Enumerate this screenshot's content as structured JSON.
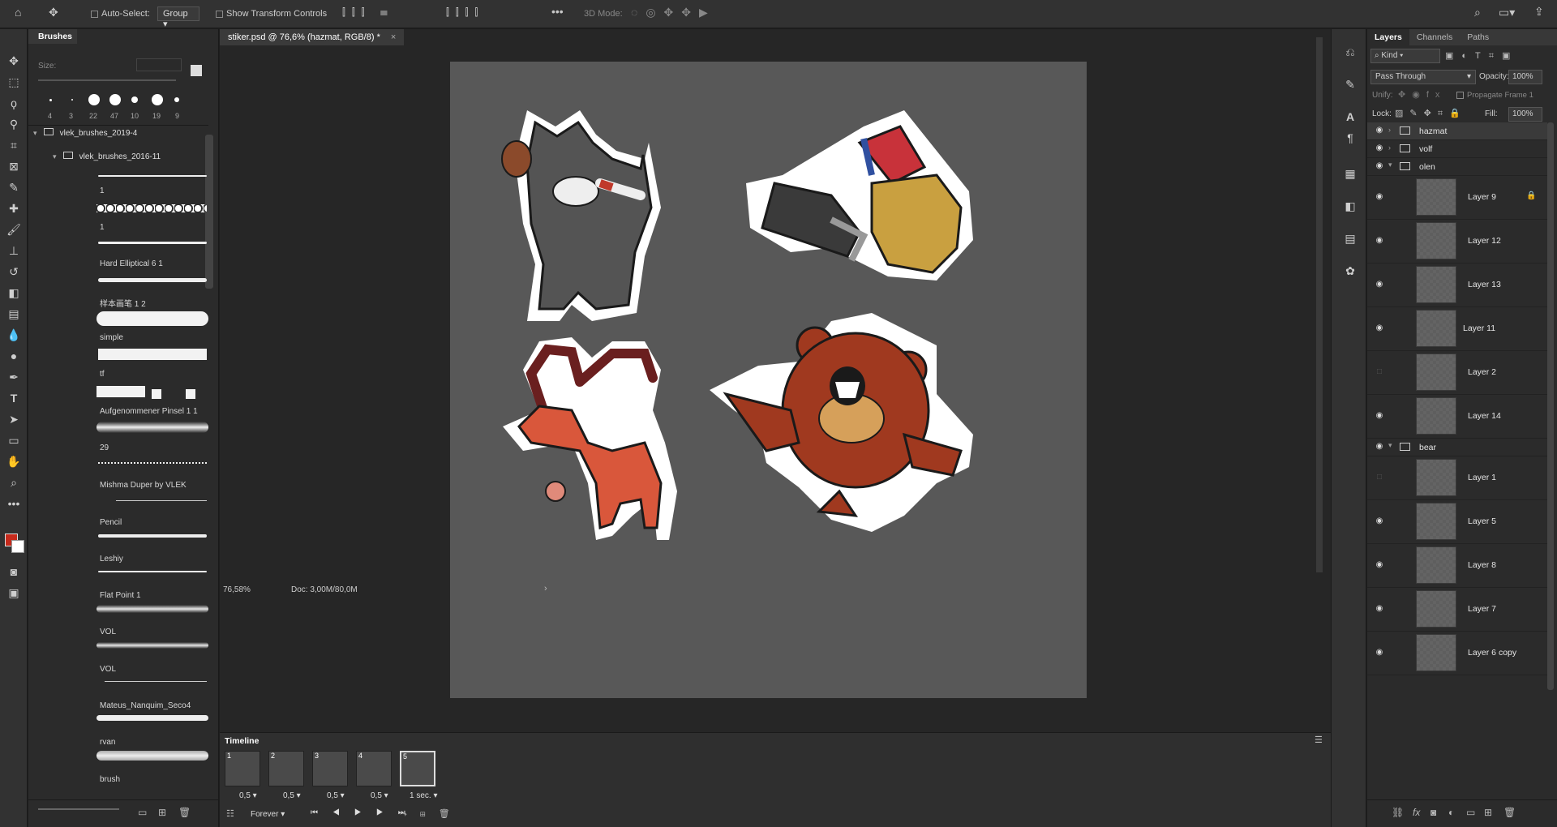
{
  "options_bar": {
    "auto_select_label": "Auto-Select:",
    "auto_select_value": "Group",
    "transform_label": "Show Transform Controls",
    "mode_3d_label": "3D Mode:"
  },
  "brushes_panel": {
    "title": "Brushes",
    "size_label": "Size:",
    "presets": [
      "4",
      "3",
      "22",
      "47",
      "10",
      "19",
      "9"
    ],
    "group1": "vlek_brushes_2019-4",
    "group2": "vlek_brushes_2016-11",
    "items": [
      "1",
      "1",
      "Hard Elliptical 6 1",
      "样本画笔 1 2",
      "simple",
      "tf",
      "Aufgenommener Pinsel 1 1",
      "29",
      "Mishma Duper by VLEK",
      "Pencil",
      "Leshiy",
      "Flat Point 1",
      "VOL",
      "VOL",
      "Mateus_Nanquim_Seco4",
      "rvan",
      "brush"
    ]
  },
  "document": {
    "tab_title": "stiker.psd @ 76,6% (hazmat, RGB/8) *",
    "zoom": "76,58%",
    "doc_size": "Doc: 3,00M/80,0M"
  },
  "timeline": {
    "title": "Timeline",
    "frames": [
      {
        "num": "1",
        "delay": "0,5"
      },
      {
        "num": "2",
        "delay": "0,5"
      },
      {
        "num": "3",
        "delay": "0,5"
      },
      {
        "num": "4",
        "delay": "0,5"
      },
      {
        "num": "5",
        "delay": "1 sec."
      }
    ],
    "loop": "Forever"
  },
  "layers_panel": {
    "tabs": [
      "Layers",
      "Channels",
      "Paths"
    ],
    "filter": "Kind",
    "blend_mode": "Pass Through",
    "opacity_label": "Opacity:",
    "opacity": "100%",
    "unify_label": "Unify:",
    "propagate_label": "Propagate Frame 1",
    "lock_label": "Lock:",
    "fill_label": "Fill:",
    "fill": "100%",
    "groups": [
      "hazmat",
      "volf",
      "olen",
      "bear"
    ],
    "layers": [
      "Layer 9",
      "Layer 12",
      "Layer 13",
      "Layer 11",
      "Layer 2",
      "Layer 14",
      "Layer 1",
      "Layer 5",
      "Layer 8",
      "Layer 7",
      "Layer 6 copy"
    ]
  },
  "colors": {
    "foreground": "#c62a1c",
    "background": "#ffffff",
    "canvas": "#585858"
  }
}
